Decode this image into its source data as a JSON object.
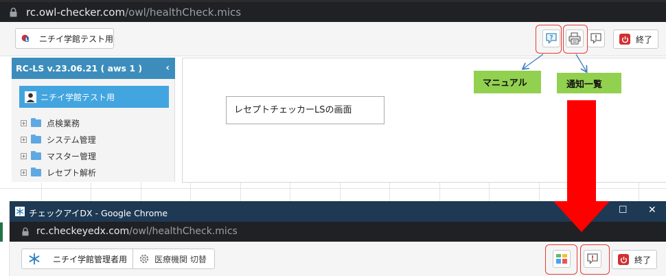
{
  "top_browser": {
    "url_host": "rc.owl-checker.com",
    "url_path": "/owl/healthCheck.mics"
  },
  "top_app": {
    "user_button_label": "ニチイ学館テスト用",
    "end_button_label": "終了",
    "sidebar": {
      "header": "RC-LS v.23.06.21 ( aws 1 )",
      "user_label": "ニチイ学館テスト用",
      "items": [
        {
          "label": "点検業務"
        },
        {
          "label": "システム管理"
        },
        {
          "label": "マスター管理"
        },
        {
          "label": "レセプト解析"
        }
      ]
    },
    "screen_label": "レセプトチェッカーLSの画面"
  },
  "callouts": {
    "manual": "マニュアル",
    "notification_list": "通知一覧"
  },
  "bottom_window": {
    "title": "チェックアイDX - Google Chrome",
    "url_host": "rc.checkeyedx.com",
    "url_path": "/owl/healthCheck.mics",
    "user_button_label": "ニチイ学館管理者用",
    "institution_button_label": "医療機関 切替",
    "end_button_label": "終了"
  },
  "colors": {
    "accent_blue": "#3c8dbc",
    "user_blue": "#42a5e0",
    "callout_green": "#92d050",
    "highlight_red": "#e53935",
    "arrow_red": "#ff0000",
    "window_title_bar": "#1e3954"
  }
}
